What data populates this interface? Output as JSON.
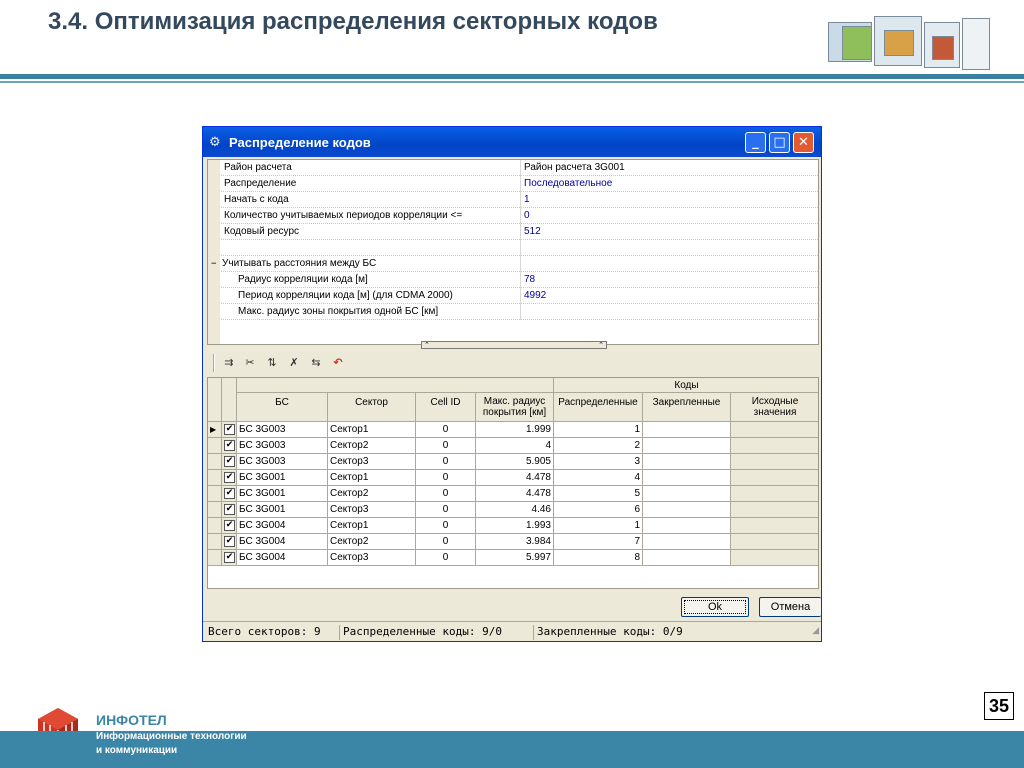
{
  "slide": {
    "title": "3.4. Оптимизация распределения секторных кодов",
    "page_number": "35"
  },
  "window": {
    "title": "Распределение кодов",
    "icon": "app-gears-icon",
    "minimize_glyph": "_",
    "maximize_glyph": "□",
    "close_glyph": "✕"
  },
  "properties": {
    "rows": [
      {
        "name": "Район расчета",
        "value": "Район расчета 3G001"
      },
      {
        "name": "Распределение",
        "value": "Последовательное"
      },
      {
        "name": "Начать с кода",
        "value": "1"
      },
      {
        "name": "Количество учитываемых периодов корреляции <=",
        "value": "0"
      },
      {
        "name": "Кодовый ресурс",
        "value": "512"
      }
    ],
    "group": {
      "collapse_glyph": "−",
      "name": "Учитывать расстояния между БС",
      "checked": true,
      "check_glyph": "✔",
      "items": [
        {
          "name": "Радиус корреляции кода [м]",
          "value": "78"
        },
        {
          "name": "Период корреляции кода [м] (для CDMA 2000)",
          "value": "4992"
        },
        {
          "name": "Макс. радиус зоны покрытия одной БС [км]",
          "value": ""
        }
      ]
    },
    "splitter_glyphs": "⌃⌃"
  },
  "toolbar": {
    "tools": [
      {
        "icon": "assign-codes-icon",
        "glyph": "⇉"
      },
      {
        "icon": "clear-codes-icon",
        "glyph": "✂"
      },
      {
        "icon": "fix-codes-icon",
        "glyph": "⇅"
      },
      {
        "icon": "unfix-codes-icon",
        "glyph": "✗"
      },
      {
        "icon": "restore-initial-icon",
        "glyph": "⇆"
      },
      {
        "icon": "undo-icon",
        "glyph": "↶"
      }
    ]
  },
  "table": {
    "group_header": "Коды",
    "columns": {
      "bs": "БС",
      "sector": "Сектор",
      "cell_id": "Cell ID",
      "max_radius": "Макс. радиус покрытия [км]",
      "distributed": "Распределенные",
      "fixed": "Закрепленные",
      "initial": "Исходные значения"
    },
    "current_row_glyph": "▶",
    "check_glyph": "✔",
    "rows": [
      {
        "bs": "БС 3G003",
        "sector": "Сектор1",
        "cell_id": "0",
        "max_radius": "1.999",
        "distributed": "1",
        "fixed": "",
        "initial": ""
      },
      {
        "bs": "БС 3G003",
        "sector": "Сектор2",
        "cell_id": "0",
        "max_radius": "4",
        "distributed": "2",
        "fixed": "",
        "initial": ""
      },
      {
        "bs": "БС 3G003",
        "sector": "Сектор3",
        "cell_id": "0",
        "max_radius": "5.905",
        "distributed": "3",
        "fixed": "",
        "initial": ""
      },
      {
        "bs": "БС 3G001",
        "sector": "Сектор1",
        "cell_id": "0",
        "max_radius": "4.478",
        "distributed": "4",
        "fixed": "",
        "initial": ""
      },
      {
        "bs": "БС 3G001",
        "sector": "Сектор2",
        "cell_id": "0",
        "max_radius": "4.478",
        "distributed": "5",
        "fixed": "",
        "initial": ""
      },
      {
        "bs": "БС 3G001",
        "sector": "Сектор3",
        "cell_id": "0",
        "max_radius": "4.46",
        "distributed": "6",
        "fixed": "",
        "initial": ""
      },
      {
        "bs": "БС 3G004",
        "sector": "Сектор1",
        "cell_id": "0",
        "max_radius": "1.993",
        "distributed": "1",
        "fixed": "",
        "initial": ""
      },
      {
        "bs": "БС 3G004",
        "sector": "Сектор2",
        "cell_id": "0",
        "max_radius": "3.984",
        "distributed": "7",
        "fixed": "",
        "initial": ""
      },
      {
        "bs": "БС 3G004",
        "sector": "Сектор3",
        "cell_id": "0",
        "max_radius": "5.997",
        "distributed": "8",
        "fixed": "",
        "initial": ""
      }
    ]
  },
  "buttons": {
    "ok": "Ok",
    "cancel": "Отмена"
  },
  "status": {
    "total": "Всего секторов: 9",
    "distributed": "Распределенные коды: 9/0",
    "fixed": "Закрепленные коды: 0/9",
    "grip_glyph": "◢"
  },
  "footer": {
    "brand": "ИНФОТЕЛ",
    "tagline_line1": "Информационные технологии",
    "tagline_line2": "и коммуникации"
  },
  "colors": {
    "title_text": "#34495e",
    "accent": "#3b86a6",
    "window_border": "#0831d9",
    "value_text": "#0000a0",
    "window_bg": "#ece9d8"
  }
}
